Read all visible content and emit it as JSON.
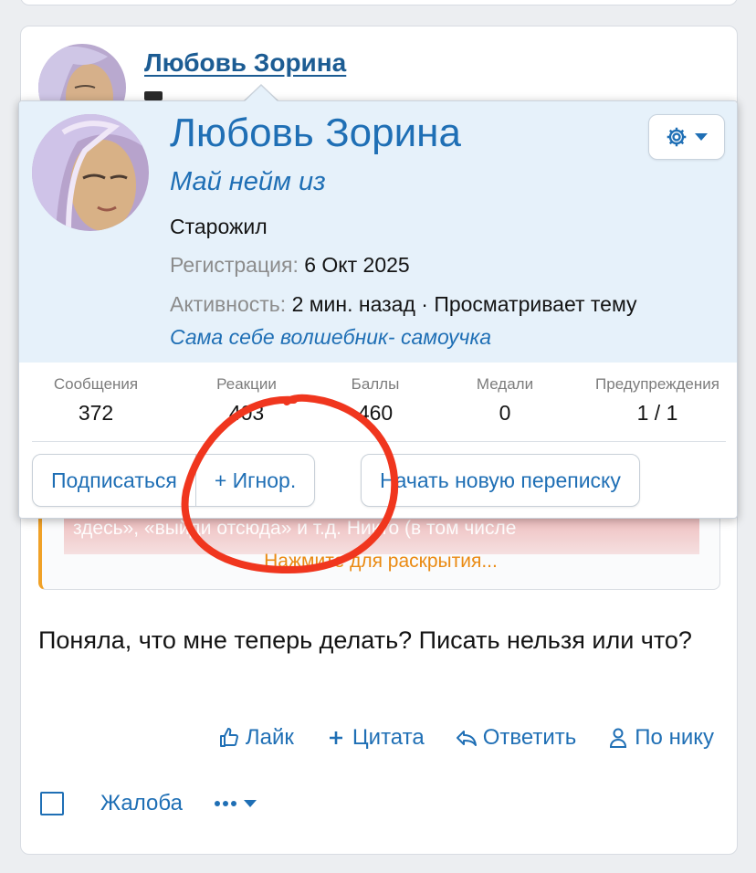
{
  "post": {
    "author_name": "Любовь Зорина",
    "quote": {
      "hidden_text": "здесь», «выйди отсюда» и т.д. Никто (в том числе",
      "expand_label": "Нажмите для раскрытия..."
    },
    "message": "Поняла, что мне теперь делать? Писать нельзя или что?",
    "actions": {
      "like": "Лайк",
      "quote": "Цитата",
      "reply": "Ответить",
      "by_nick": "По нику"
    },
    "footer": {
      "report": "Жалоба"
    }
  },
  "popup": {
    "name": "Любовь Зорина",
    "custom_title": "Май нейм из",
    "rank": "Старожил",
    "registration_label": "Регистрация:",
    "registration_value": "6 Окт 2025",
    "activity_label": "Активность:",
    "activity_value": "2 мин. назад · Просматривает тему",
    "signature": "Сама себе волшебник- самоучка",
    "stats": [
      {
        "label": "Сообщения",
        "value": "372"
      },
      {
        "label": "Реакции",
        "value": "403"
      },
      {
        "label": "Баллы",
        "value": "460"
      },
      {
        "label": "Медали",
        "value": "0"
      },
      {
        "label": "Предупреждения",
        "value": "1 / 1"
      }
    ],
    "buttons": {
      "follow": "Подписаться",
      "ignore": "+ Игнор.",
      "start_conversation": "Начать новую переписку"
    }
  },
  "colors": {
    "link": "#1f6fb5",
    "popup_header_bg": "#e6f1fa",
    "quote_accent": "#f0a127",
    "annotation": "#f0361e"
  },
  "icons": [
    "gear-icon",
    "caret-down-icon",
    "thumbs-up-icon",
    "plus-icon",
    "reply-icon",
    "user-icon",
    "checkbox-icon",
    "ellipsis-icon"
  ]
}
